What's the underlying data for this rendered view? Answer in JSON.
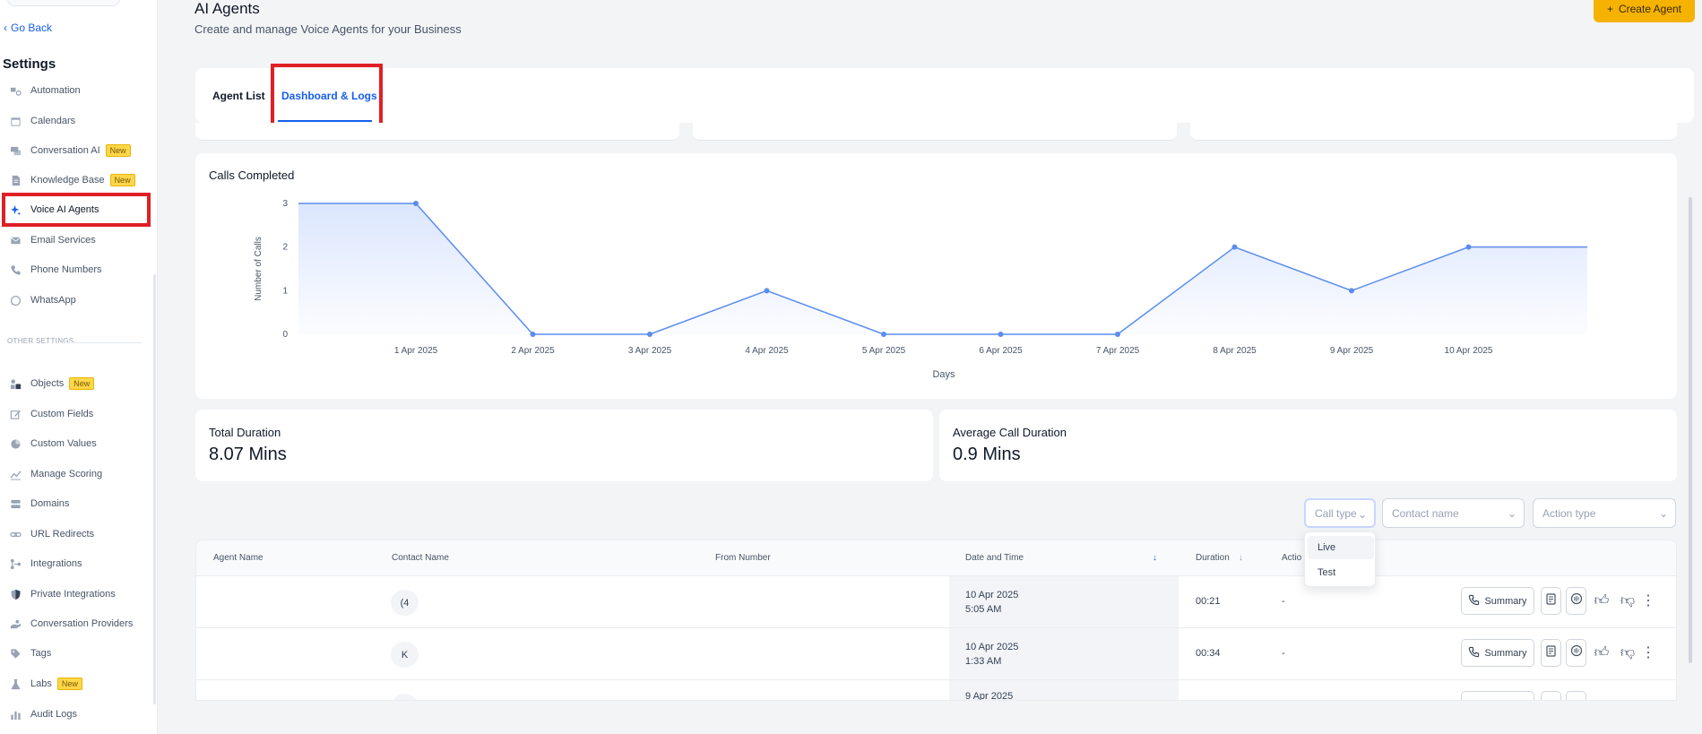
{
  "sidebar": {
    "go_back": "Go Back",
    "settings_title": "Settings",
    "section_other": "OTHER SETTINGS",
    "badge_new": "New",
    "items": [
      {
        "label": "Automation",
        "icon": "automation-icon"
      },
      {
        "label": "Calendars",
        "icon": "calendar-icon"
      },
      {
        "label": "Conversation AI",
        "icon": "chat-icon",
        "badge": "New"
      },
      {
        "label": "Knowledge Base",
        "icon": "document-icon",
        "badge": "New"
      },
      {
        "label": "Voice AI Agents",
        "icon": "sparkle-icon"
      },
      {
        "label": "Email Services",
        "icon": "mail-icon"
      },
      {
        "label": "Phone Numbers",
        "icon": "phone-icon"
      },
      {
        "label": "WhatsApp",
        "icon": "whatsapp-icon"
      }
    ],
    "other_items": [
      {
        "label": "Objects",
        "icon": "objects-icon",
        "badge": "New"
      },
      {
        "label": "Custom Fields",
        "icon": "edit-icon"
      },
      {
        "label": "Custom Values",
        "icon": "pie-icon"
      },
      {
        "label": "Manage Scoring",
        "icon": "trend-icon"
      },
      {
        "label": "Domains",
        "icon": "server-icon"
      },
      {
        "label": "URL Redirects",
        "icon": "link-icon"
      },
      {
        "label": "Integrations",
        "icon": "integrations-icon"
      },
      {
        "label": "Private Integrations",
        "icon": "shield-icon"
      },
      {
        "label": "Conversation Providers",
        "icon": "hand-icon"
      },
      {
        "label": "Tags",
        "icon": "tag-icon"
      },
      {
        "label": "Labs",
        "icon": "flask-icon",
        "badge": "New"
      },
      {
        "label": "Audit Logs",
        "icon": "bar-chart-icon"
      }
    ]
  },
  "header": {
    "title": "AI Agents",
    "subtitle": "Create and manage Voice Agents for your Business",
    "create_button": "Create Agent"
  },
  "tabs": {
    "agent_list": "Agent List",
    "dashboard_logs": "Dashboard & Logs"
  },
  "chart_data": {
    "type": "area",
    "title": "Calls Completed",
    "xlabel": "Days",
    "ylabel": "Number of Calls",
    "ylim": [
      0,
      3
    ],
    "yticks": [
      "0",
      "1",
      "2",
      "3"
    ],
    "categories": [
      "1 Apr 2025",
      "2 Apr 2025",
      "3 Apr 2025",
      "4 Apr 2025",
      "5 Apr 2025",
      "6 Apr 2025",
      "7 Apr 2025",
      "8 Apr 2025",
      "9 Apr 2025",
      "10 Apr 2025"
    ],
    "values": [
      3,
      0,
      0,
      1,
      0,
      0,
      0,
      2,
      1,
      2
    ],
    "color": "#5b8def",
    "fill": "#dbe6fd"
  },
  "stats": {
    "total_label": "Total Duration",
    "total_value": "8.07 Mins",
    "avg_label": "Average Call Duration",
    "avg_value": "0.9 Mins"
  },
  "filters": {
    "call_type": "Call type",
    "contact_name": "Contact name",
    "action_type": "Action type",
    "options": [
      "Live",
      "Test"
    ]
  },
  "table": {
    "headers": {
      "agent_name": "Agent Name",
      "contact_name": "Contact Name",
      "from_number": "From Number",
      "date_time": "Date and Time",
      "duration": "Duration",
      "action": "Actio"
    },
    "summary_label": "Summary",
    "rows": [
      {
        "avatar": "(4",
        "date": "10 Apr 2025",
        "time": "5:05 AM",
        "duration": "00:21",
        "action": "-"
      },
      {
        "avatar": "K",
        "date": "10 Apr 2025",
        "time": "1:33 AM",
        "duration": "00:34",
        "action": "-"
      },
      {
        "avatar": "",
        "date": "9 Apr 2025",
        "time": "",
        "duration": "",
        "action": ""
      }
    ]
  }
}
